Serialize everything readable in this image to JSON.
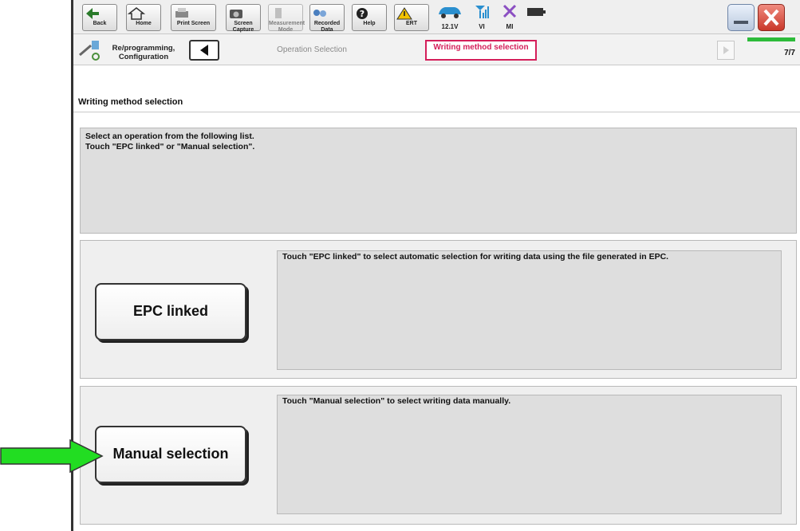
{
  "toolbar": {
    "buttons": [
      {
        "label": "Back",
        "icon": "back-arrow-icon"
      },
      {
        "label": "Home",
        "icon": "home-icon"
      },
      {
        "label": "Print Screen",
        "icon": "printer-icon"
      },
      {
        "label": "Screen Capture",
        "icon": "camera-icon"
      },
      {
        "label": "Measurement Mode",
        "icon": "measurement-icon"
      },
      {
        "label": "Recorded Data",
        "icon": "recorded-data-icon"
      },
      {
        "label": "Help",
        "icon": "help-icon"
      },
      {
        "label": "ERT",
        "icon": "warning-icon"
      }
    ],
    "status": {
      "voltage": "12.1V",
      "vi": "VI",
      "mi": "MI"
    }
  },
  "nav": {
    "section_label": "Re/programming, Configuration",
    "steps": [
      "Operation Selection",
      "Writing method selection"
    ],
    "page_indicator": "7/7",
    "progress_fraction": 1.0
  },
  "page": {
    "title": "Writing method selection",
    "instruction_line1": "Select an operation from the following list.",
    "instruction_line2": "Touch \"EPC linked\" or \"Manual selection\"."
  },
  "options": [
    {
      "button_label": "EPC linked",
      "description": "Touch \"EPC linked\" to select automatic selection for writing data using the file generated in EPC."
    },
    {
      "button_label": "Manual selection",
      "description": "Touch \"Manual selection\" to select writing data manually."
    }
  ],
  "colors": {
    "accent": "#d41f5a",
    "progress": "#2dbb3a",
    "arrow": "#22dd22"
  }
}
